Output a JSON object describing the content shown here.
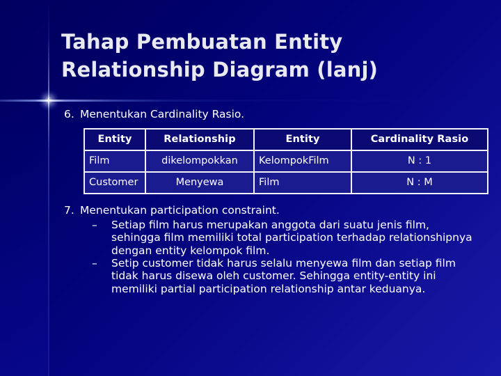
{
  "slide": {
    "title": "Tahap Pembuatan Entity Relationship Diagram (lanj)",
    "background_color_top_left": "#00005c",
    "background_color_bottom_right": "#1818a8",
    "title_color": "#e9e9f2",
    "body_color": "#ffffff",
    "table_header_bg": "#0a0a72",
    "table_row_bg": "#1b1b90",
    "table_border_color": "#f2f2fa"
  },
  "steps": [
    {
      "number": "6.",
      "text": "Menentukan Cardinality Rasio."
    },
    {
      "number": "7.",
      "text": "Menentukan participation constraint."
    }
  ],
  "table": {
    "headers": [
      "Entity",
      "Relationship",
      "Entity",
      "Cardinality Rasio"
    ],
    "rows": [
      [
        "Film",
        "dikelompokkan",
        "KelompokFilm",
        "N : 1"
      ],
      [
        "Customer",
        "Menyewa",
        "Film",
        "N : M"
      ]
    ]
  },
  "sub_bullets": {
    "dash": "–",
    "items": [
      "Setiap film harus merupakan anggota dari suatu jenis film, sehingga film memiliki total participation terhadap relationshipnya dengan entity kelompok film.",
      "Setip customer tidak harus selalu menyewa film dan setiap film tidak harus disewa oleh customer. Sehingga entity-entity ini memiliki partial participation relationship antar keduanya."
    ]
  }
}
